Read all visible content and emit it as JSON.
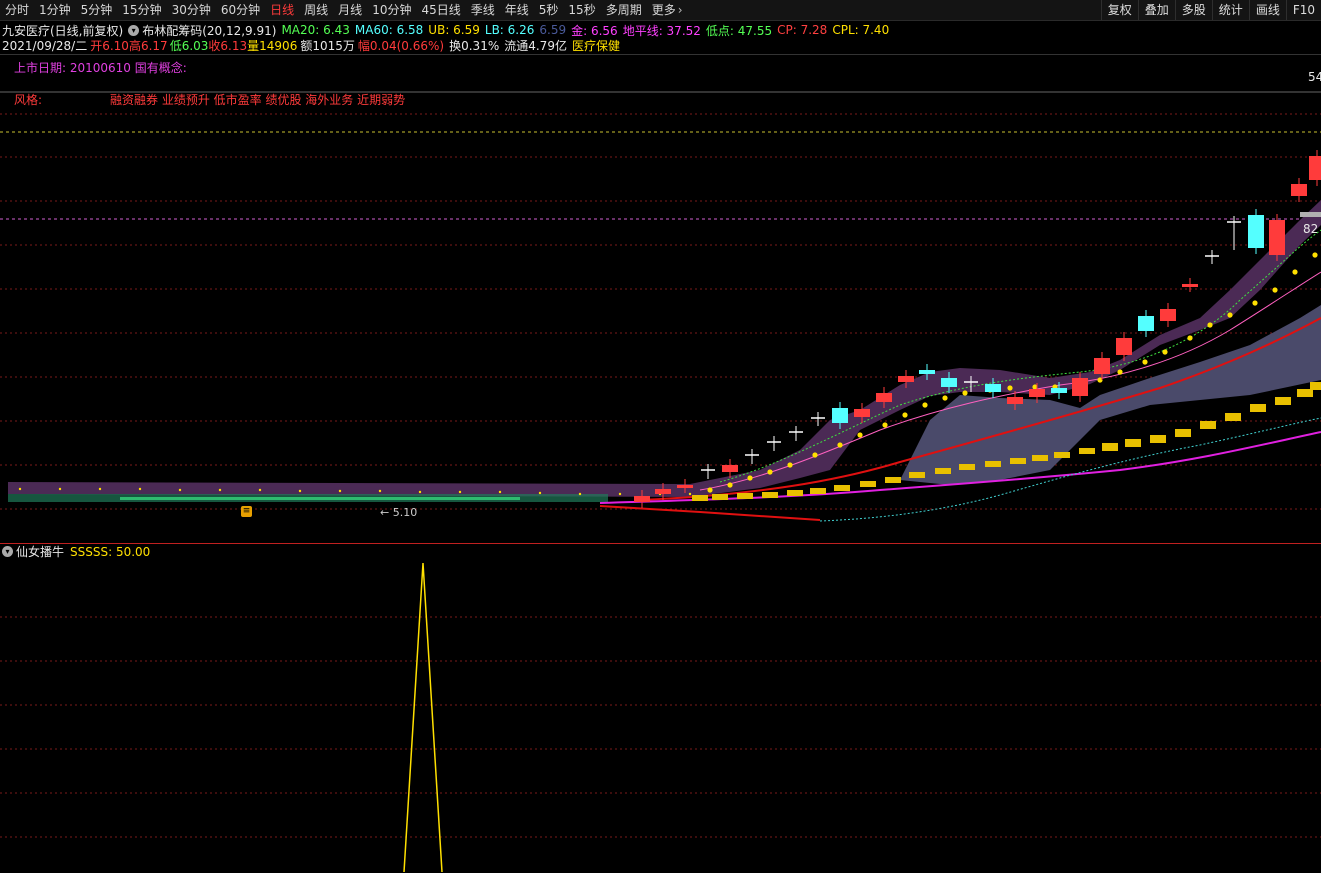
{
  "toolbar": {
    "periods": [
      "分时",
      "1分钟",
      "5分钟",
      "15分钟",
      "30分钟",
      "60分钟",
      "日线",
      "周线",
      "月线",
      "10分钟",
      "45日线",
      "季线",
      "年线",
      "5秒",
      "15秒",
      "多周期",
      "更多"
    ],
    "active_period": "日线",
    "right_buttons": [
      "复权",
      "叠加",
      "多股",
      "统计",
      "画线",
      "F10"
    ]
  },
  "header": {
    "stock_name": "九安医疗(日线,前复权)",
    "indicator_name": "布林配筹码(20,12,9.91)",
    "ma20": "MA20: 6.43",
    "ma60": "MA60: 6.58",
    "ub": "UB: 6.59",
    "lb": "LB: 6.26",
    "dim_value": "6.59",
    "gold": "金: 6.56",
    "dipingxian": "地平线: 37.52",
    "lowpoint": "低点: 47.55",
    "cp": "CP: 7.28",
    "cpl": "CPL: 7.40"
  },
  "quote": {
    "date": "2021/09/28/二",
    "open": "开6.10",
    "high": "高6.17",
    "low": "低6.03",
    "close": "收6.13",
    "volume": "量14906",
    "amount": "额1015万",
    "change": "幅0.04(0.66%)",
    "turnover": "换0.31%",
    "float": "流通4.79亿",
    "sector": "医疗保健"
  },
  "annotations": {
    "listing": "上市日期:  20100610    国有概念:",
    "style_label": "风格:",
    "style_tags": "融资融券 业绩预升 低市盈率 绩优股 海外业务 近期弱势",
    "right_price_top": "54",
    "right_price_mid": "82",
    "low_marker": "← 5.10"
  },
  "sub_indicator": {
    "name": "仙女播牛",
    "value": "SSSSS: 50.00"
  },
  "colors": {
    "up": "#ff3b3b",
    "down": "#54ffff",
    "ma_red": "#e01010",
    "ma_magenta": "#e020e0",
    "band": "#4a4a6a",
    "cloud": "#4b2a55",
    "yellow": "#ffe000",
    "gold_bar": "#e8c000"
  }
}
